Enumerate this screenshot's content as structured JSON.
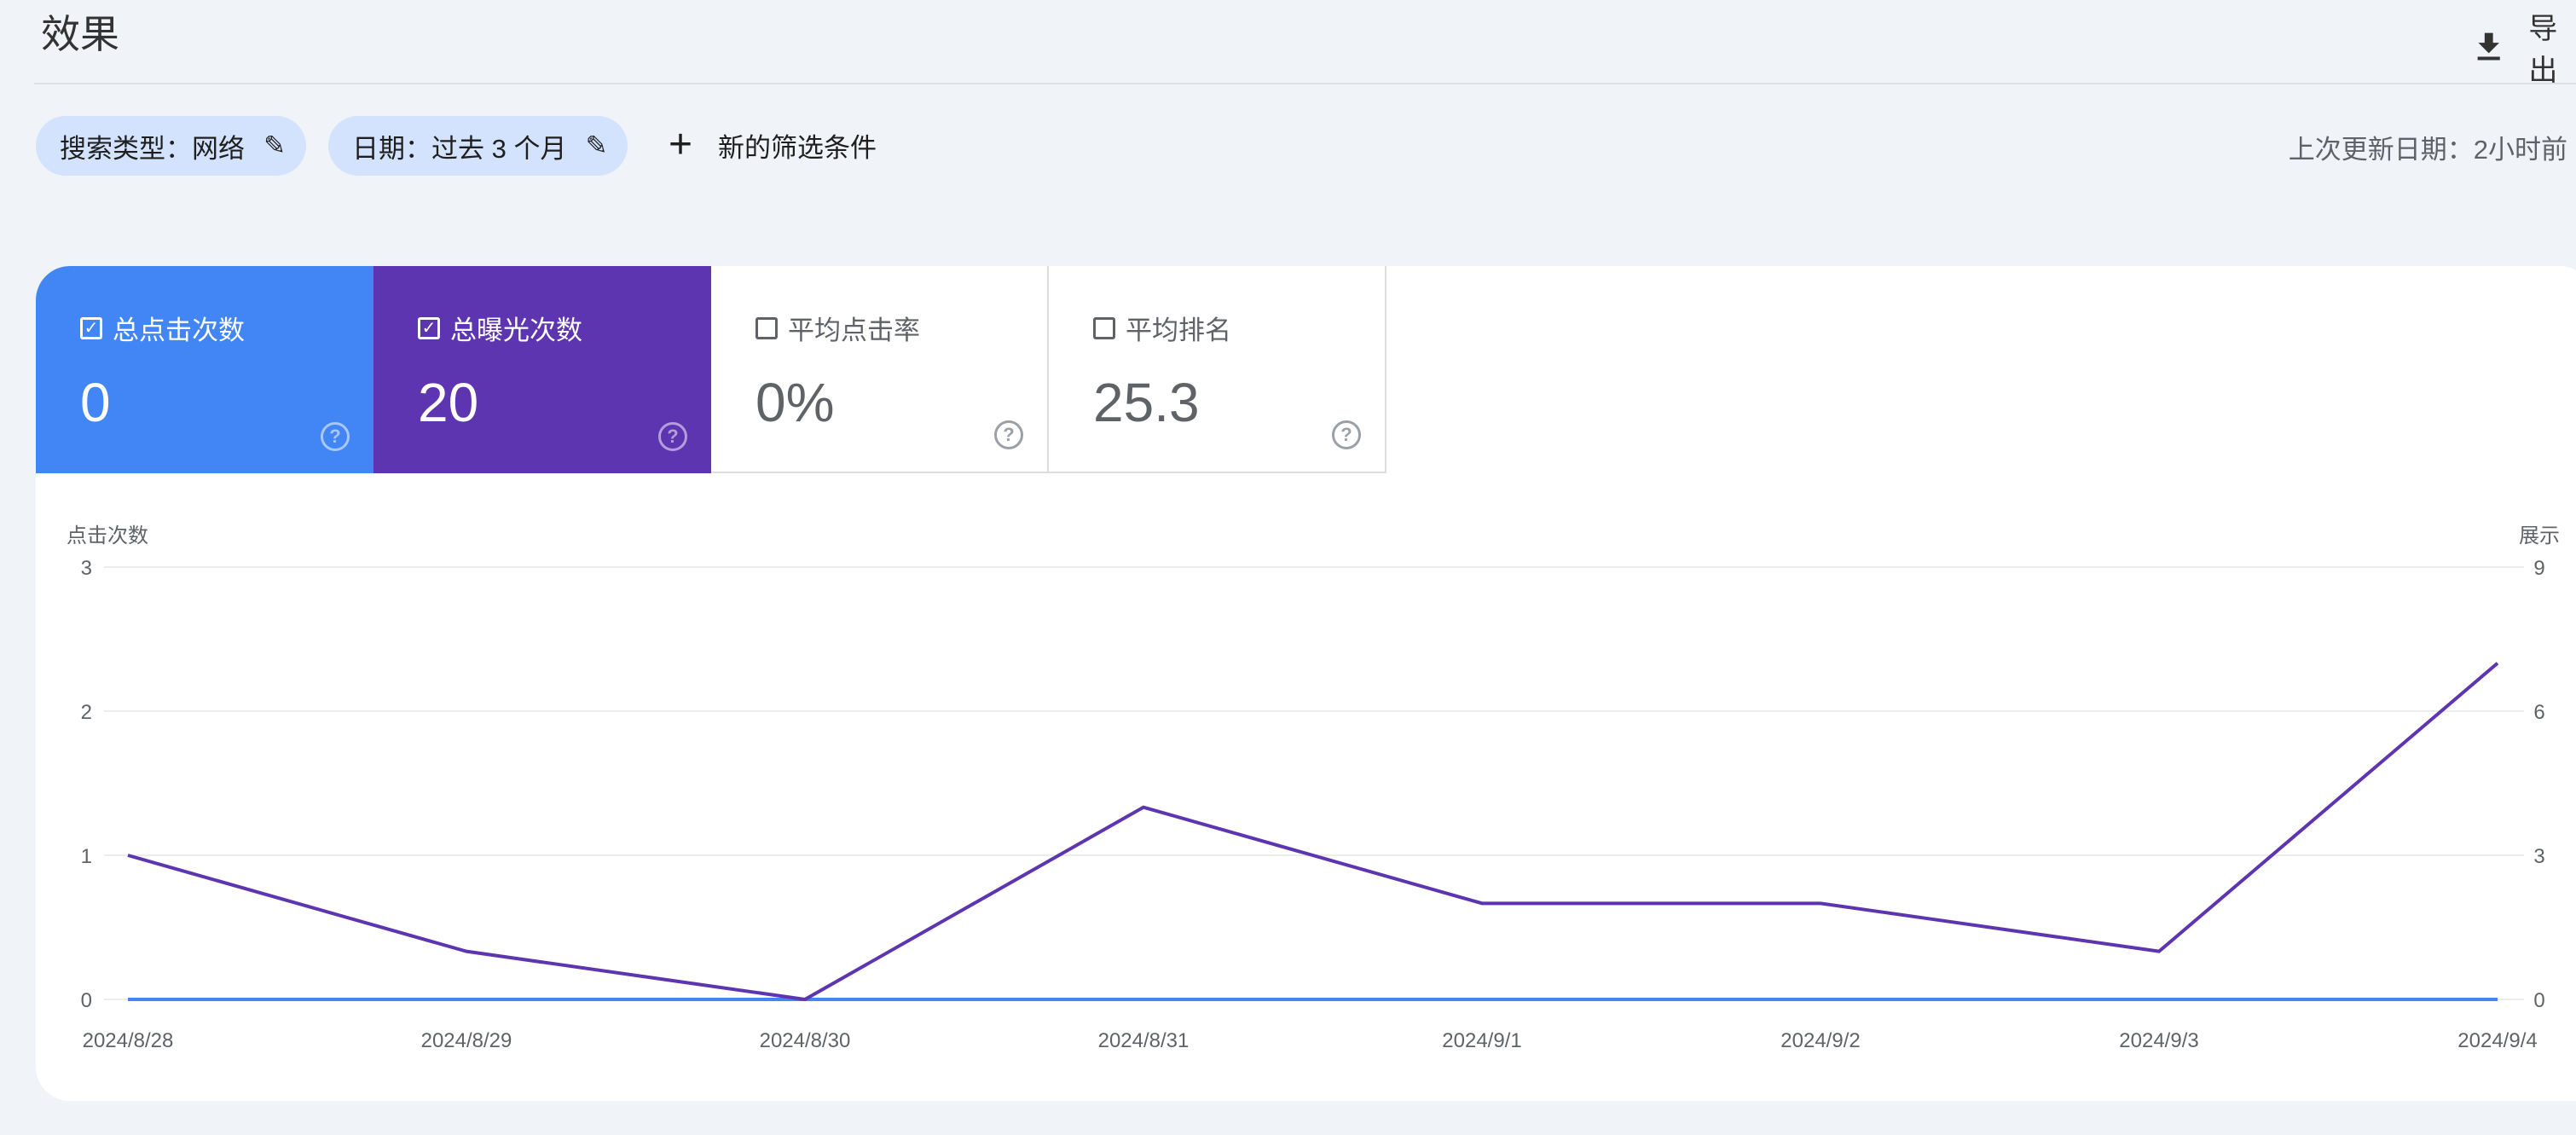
{
  "header": {
    "title": "效果",
    "export_label": "导出"
  },
  "filters": [
    {
      "label": "搜索类型：网络"
    },
    {
      "label": "日期：过去 3 个月"
    }
  ],
  "add_filter_label": "新的筛选条件",
  "last_updated": "上次更新日期：2小时前",
  "metrics": [
    {
      "label": "总点击次数",
      "value": "0",
      "checked": true,
      "color": "#4285f4"
    },
    {
      "label": "总曝光次数",
      "value": "20",
      "checked": true,
      "color": "#5e35b1"
    },
    {
      "label": "平均点击率",
      "value": "0%",
      "checked": false
    },
    {
      "label": "平均排名",
      "value": "25.3",
      "checked": false
    }
  ],
  "chart_data": {
    "type": "line",
    "x": [
      "2024/8/28",
      "2024/8/29",
      "2024/8/30",
      "2024/8/31",
      "2024/9/1",
      "2024/9/2",
      "2024/9/3",
      "2024/9/4"
    ],
    "ylabel": "点击次数",
    "ylabel_right": "展示",
    "ylim": [
      0,
      3
    ],
    "ylim_right": [
      0,
      9
    ],
    "yticks": [
      "0",
      "1",
      "2",
      "3"
    ],
    "yticks_right": [
      "0",
      "3",
      "6",
      "9"
    ],
    "grid": true,
    "series": [
      {
        "axis": "left",
        "color": "#4285f4",
        "values": [
          0,
          0,
          0,
          0,
          0,
          0,
          0,
          0
        ]
      },
      {
        "axis": "right",
        "color": "#5e35b1",
        "values": [
          3,
          1,
          0,
          4,
          2,
          2,
          1,
          7
        ]
      }
    ]
  }
}
